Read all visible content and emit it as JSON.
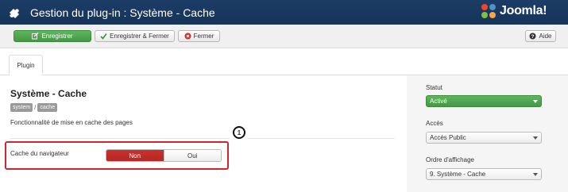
{
  "header": {
    "title": "Gestion du plug-in : Système - Cache",
    "logo_text": "Joomla!"
  },
  "toolbar": {
    "save_label": "Enregistrer",
    "save_close_label": "Enregistrer & Fermer",
    "close_label": "Fermer",
    "help_label": "Aide"
  },
  "tabs": [
    {
      "label": "Plugin"
    }
  ],
  "plugin": {
    "title": "Système - Cache",
    "tags": [
      "system",
      "cache"
    ],
    "tag_separator": "/",
    "description": "Fonctionnalité de mise en cache des pages"
  },
  "callout": "1",
  "form": {
    "browser_cache_label": "Cache du navigateur",
    "options": [
      "Non",
      "Oui"
    ],
    "selected": "Non"
  },
  "sidebar": {
    "status_label": "Statut",
    "status_value": "Activé",
    "access_label": "Accès",
    "access_value": "Accès Public",
    "order_label": "Ordre d'affichage",
    "order_value": "9. Système - Cache"
  },
  "colors": {
    "header_bg": "#1c3d66",
    "save_green": "#5cb85c",
    "active_red": "#c9302c",
    "highlight_red": "#d0262d"
  },
  "icons": {
    "header": "puzzle-icon",
    "save": "edit-icon",
    "save_close": "check-icon",
    "close": "close-icon",
    "help": "question-icon"
  }
}
